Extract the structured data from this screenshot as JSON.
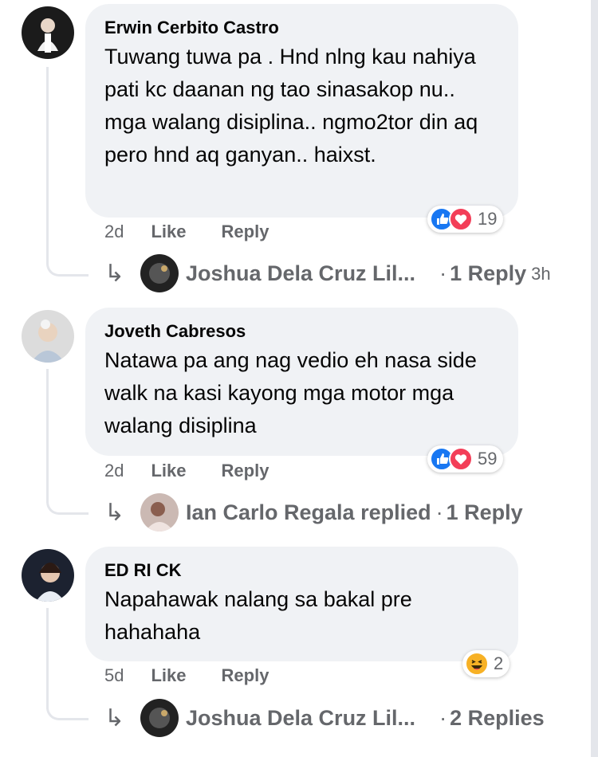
{
  "comments": [
    {
      "author": "Erwin Cerbito Castro",
      "text": "Tuwang tuwa pa . Hnd nlng kau nahiya pati kc daanan ng tao sinasakop nu.. mga walang disiplina.. ngmo2tor din aq pero hnd aq ganyan.. haixst.",
      "time": "2d",
      "like_label": "Like",
      "reply_label": "Reply",
      "reactions": [
        "like",
        "love"
      ],
      "reaction_count": "19",
      "reply_preview": {
        "name": "Joshua Dela Cruz Lil...",
        "separator": "·",
        "count": "1 Reply",
        "time": "3h"
      }
    },
    {
      "author": "Joveth Cabresos",
      "text": "Natawa pa ang nag vedio eh nasa side walk na kasi kayong mga motor mga walang disiplina",
      "time": "2d",
      "like_label": "Like",
      "reply_label": "Reply",
      "reactions": [
        "like",
        "love"
      ],
      "reaction_count": "59",
      "reply_preview": {
        "name": "Ian Carlo Regala replied",
        "separator": "·",
        "count": "1 Reply"
      }
    },
    {
      "author": "ED RI CK",
      "text": "Napahawak nalang sa bakal pre hahahaha",
      "time": "5d",
      "like_label": "Like",
      "reply_label": "Reply",
      "reactions": [
        "haha"
      ],
      "reaction_count": "2",
      "reply_preview": {
        "name": "Joshua Dela Cruz Lil...",
        "separator": "·",
        "count": "2 Replies"
      }
    }
  ],
  "colors": {
    "bubble": "#f0f2f5",
    "meta_text": "#65676b",
    "like_blue": "#1877f2",
    "love_red": "#f33e58",
    "haha_yellow": "#f7b125"
  }
}
